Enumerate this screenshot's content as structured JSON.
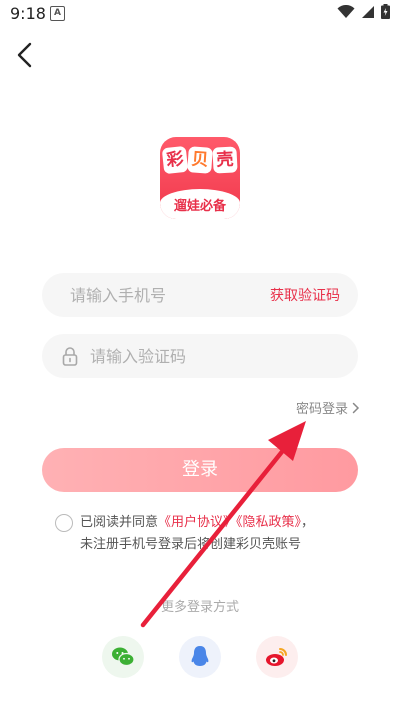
{
  "status": {
    "time": "9:18",
    "notif": "A"
  },
  "logo": {
    "chars": [
      "彩",
      "贝",
      "壳"
    ],
    "slogan": "遛娃必备"
  },
  "form": {
    "phone_placeholder": "请输入手机号",
    "code_placeholder": "请输入验证码",
    "get_code": "获取验证码",
    "password_login": "密码登录",
    "login": "登录"
  },
  "agreement": {
    "prefix": "已阅读并同意",
    "user_agreement": "《用户协议》",
    "privacy_policy": "《隐私政策》",
    "comma": "，",
    "line2": "未注册手机号登录后将创建彩贝壳账号"
  },
  "more_login": "更多登录方式",
  "social": [
    "wechat-icon",
    "qq-icon",
    "weibo-icon"
  ],
  "colors": {
    "accent": "#e8304a",
    "button": "#ffa4a9",
    "arrow": "#e8203a"
  }
}
